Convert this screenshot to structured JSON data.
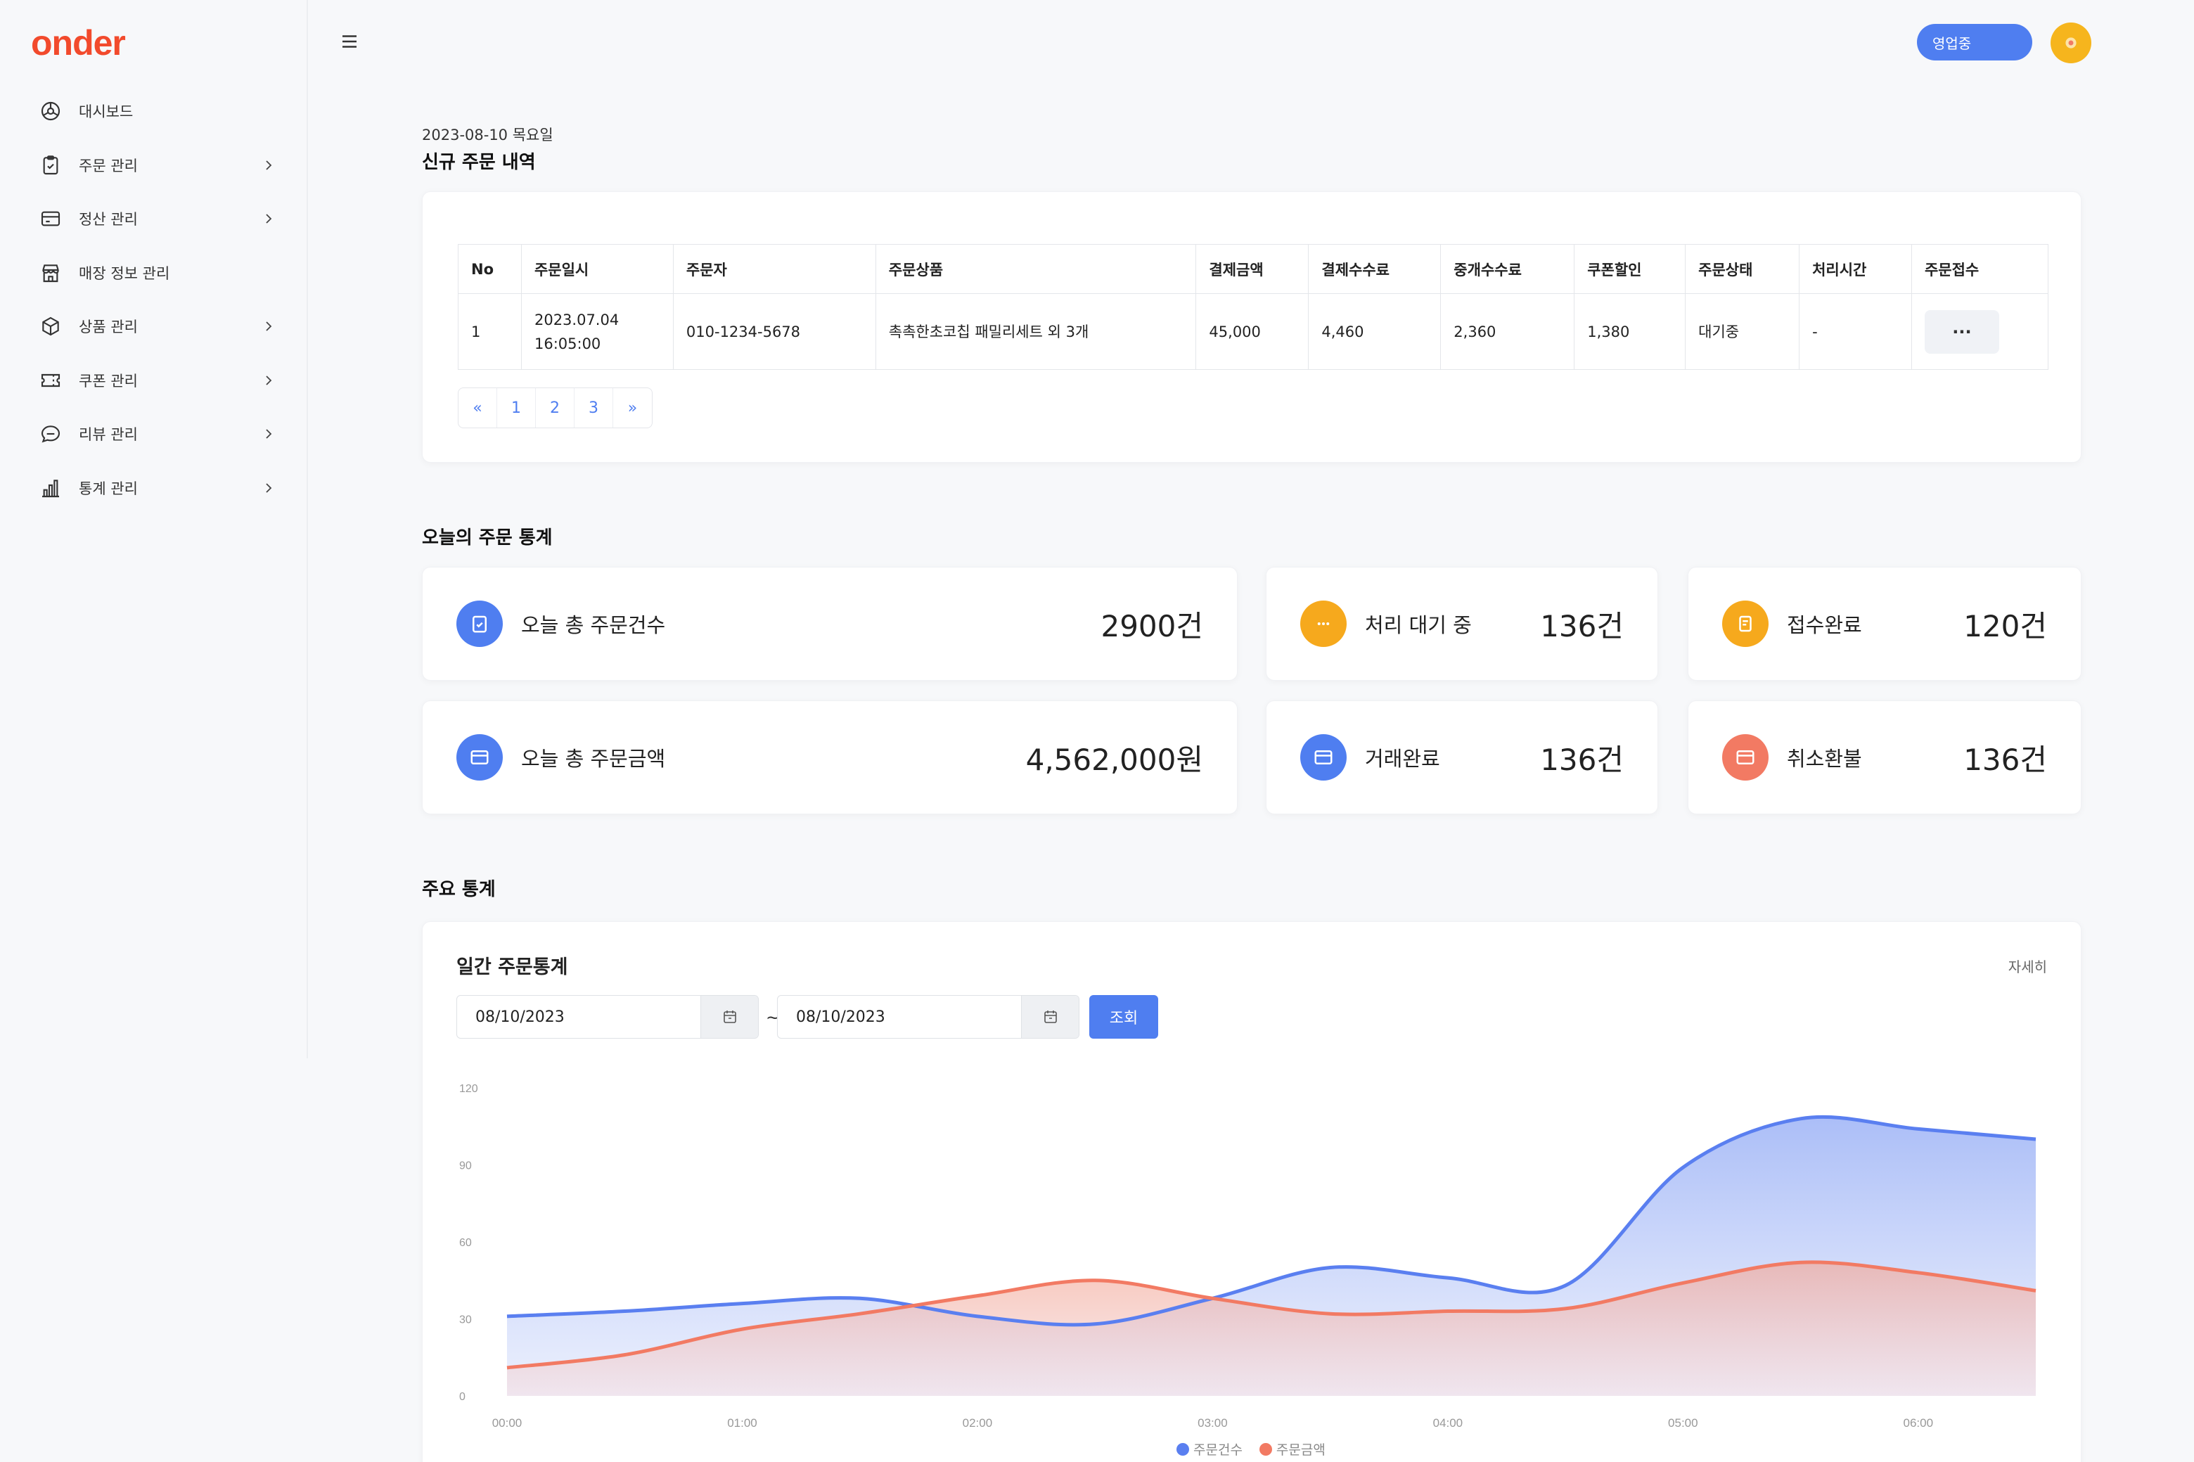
{
  "brand": {
    "logo": "onder",
    "accent": "#f24a2c",
    "primary": "#4f7ef0"
  },
  "sidebar": {
    "items": [
      {
        "label": "대시보드",
        "icon": "dashboard-icon",
        "has_submenu": false
      },
      {
        "label": "주문 관리",
        "icon": "clipboard-icon",
        "has_submenu": true
      },
      {
        "label": "정산 관리",
        "icon": "card-icon",
        "has_submenu": true
      },
      {
        "label": "매장 정보 관리",
        "icon": "store-icon",
        "has_submenu": false
      },
      {
        "label": "상품 관리",
        "icon": "box-icon",
        "has_submenu": true
      },
      {
        "label": "쿠폰 관리",
        "icon": "coupon-icon",
        "has_submenu": true
      },
      {
        "label": "리뷰 관리",
        "icon": "chat-icon",
        "has_submenu": true
      },
      {
        "label": "통계 관리",
        "icon": "bar-chart-icon",
        "has_submenu": true
      }
    ]
  },
  "header": {
    "status_label": "영업중"
  },
  "page": {
    "date": "2023-08-10 목요일",
    "new_orders_title": "신규 주문 내역",
    "today_stats_title": "오늘의 주문 통계",
    "main_stats_title": "주요 통계"
  },
  "orders_table": {
    "columns": [
      "No",
      "주문일시",
      "주문자",
      "주문상품",
      "결제금액",
      "결제수수료",
      "중개수수료",
      "쿠폰할인",
      "주문상태",
      "처리시간",
      "주문접수"
    ],
    "rows": [
      {
        "no": "1",
        "date_line1": "2023.07.04",
        "date_line2": "16:05:00",
        "customer": "010-1234-5678",
        "product": "촉촉한초코칩 패밀리세트 외 3개",
        "payment": "45,000",
        "payment_fee": "4,460",
        "broker_fee": "2,360",
        "coupon": "1,380",
        "status": "대기중",
        "process_time": "-",
        "action_label": "···"
      }
    ],
    "pagination": [
      "«",
      "1",
      "2",
      "3",
      "»"
    ]
  },
  "stats": {
    "total_orders": {
      "label": "오늘 총 주문건수",
      "value": "2900건",
      "color": "#4f7ef0"
    },
    "pending": {
      "label": "처리 대기 중",
      "value": "136건",
      "color": "#f6a91d"
    },
    "accepted": {
      "label": "접수완료",
      "value": "120건",
      "color": "#f6a91d"
    },
    "total_amount": {
      "label": "오늘 총 주문금액",
      "value": "4,562,000원",
      "color": "#4f7ef0"
    },
    "completed": {
      "label": "거래완료",
      "value": "136건",
      "color": "#4f7ef0"
    },
    "refund": {
      "label": "취소환불",
      "value": "136건",
      "color": "#f27a63"
    }
  },
  "daily_chart": {
    "title": "일간 주문통계",
    "detail_label": "자세히",
    "date_from": "08/10/2023",
    "date_to": "08/10/2023",
    "tilde": "~",
    "search_label": "조회"
  },
  "chart_data": {
    "type": "area",
    "x": [
      "00:00",
      "00:30",
      "01:00",
      "01:30",
      "02:00",
      "02:30",
      "03:00",
      "03:30",
      "04:00",
      "04:30",
      "05:00",
      "05:30",
      "06:00",
      "06:30"
    ],
    "xticks": [
      "00:00",
      "01:00",
      "02:00",
      "03:00",
      "04:00",
      "05:00",
      "06:00"
    ],
    "yticks": [
      0,
      30,
      60,
      90,
      120
    ],
    "ylim": [
      0,
      120
    ],
    "series": [
      {
        "name": "주문건수",
        "color": "#5a7ff0",
        "values": [
          31,
          33,
          36,
          38,
          31,
          28,
          38,
          50,
          46,
          43,
          89,
          108,
          104,
          100
        ]
      },
      {
        "name": "주문금액",
        "color": "#f27a63",
        "values": [
          11,
          16,
          26,
          32,
          39,
          45,
          38,
          32,
          33,
          34,
          44,
          52,
          48,
          41
        ]
      }
    ],
    "grid": false,
    "legend": "bottom"
  }
}
